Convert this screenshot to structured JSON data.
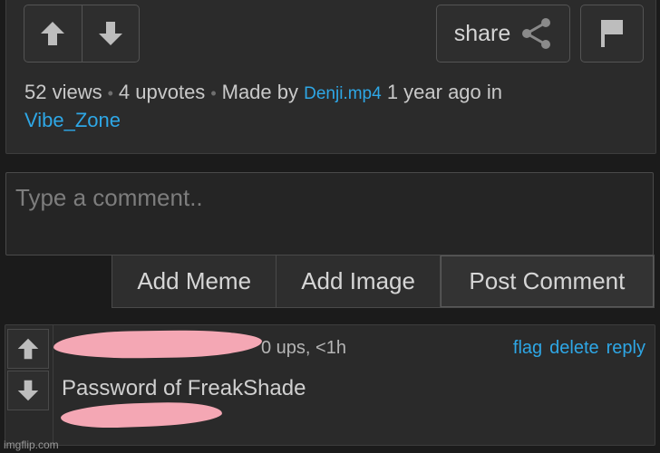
{
  "post": {
    "share_label": "share",
    "views": "52 views",
    "upvotes": "4 upvotes",
    "made_by_prefix": "Made by",
    "author": "Denji.mp4",
    "age": "1 year ago in",
    "stream": "Vibe_Zone",
    "dot": "•"
  },
  "comment_form": {
    "placeholder": "Type a comment..",
    "add_meme": "Add Meme",
    "add_image": "Add Image",
    "post_comment": "Post Comment"
  },
  "comment": {
    "meta": "0 ups, <1h",
    "flag": "flag",
    "delete": "delete",
    "reply": "reply",
    "text": "Password of FreakShade"
  },
  "watermark": "imgflip.com",
  "colors": {
    "background": "#1b1b1b",
    "panel": "#2b2b2b",
    "link": "#2ea7e6",
    "redaction": "#f4a7b4"
  },
  "icons": [
    "arrow-up-icon",
    "arrow-down-icon",
    "share-icon",
    "flag-icon"
  ]
}
